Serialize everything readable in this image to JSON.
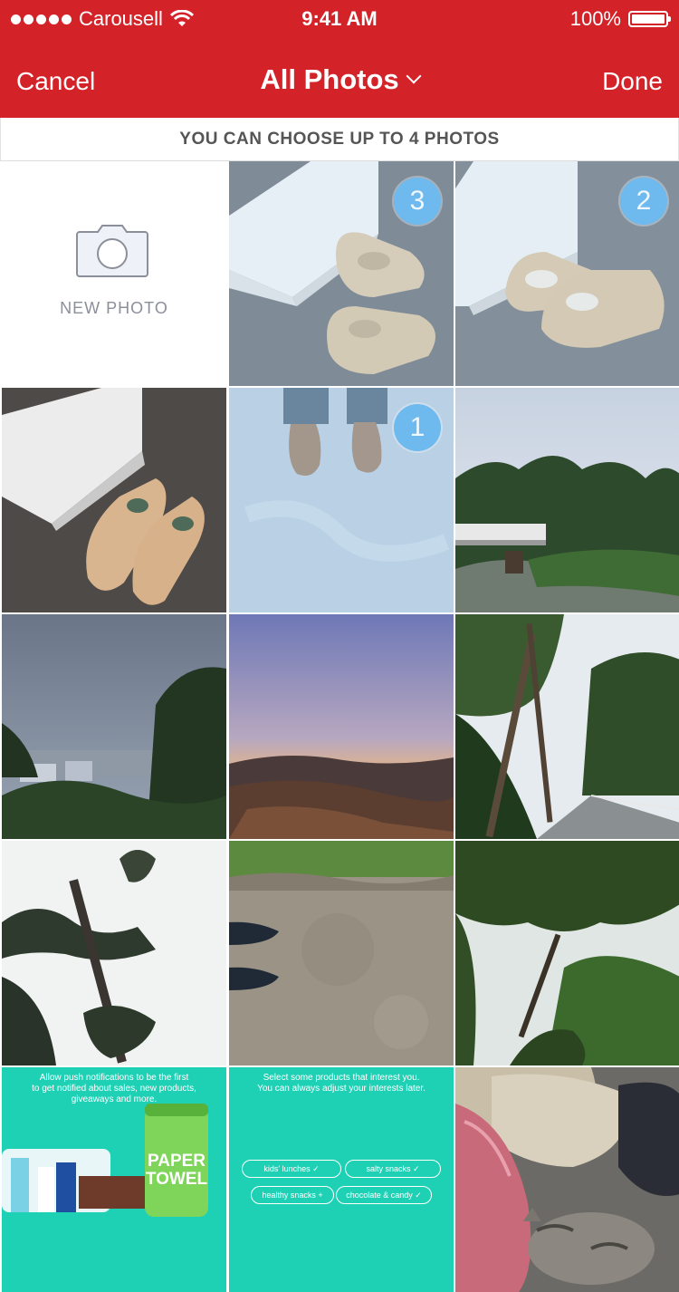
{
  "status_bar": {
    "carrier": "Carousell",
    "time": "9:41 AM",
    "battery": "100%"
  },
  "nav": {
    "cancel": "Cancel",
    "title": "All Photos",
    "done": "Done"
  },
  "hint": "YOU CAN CHOOSE UP TO 4 PHOTOS",
  "new_photo": {
    "label": "NEW PHOTO"
  },
  "selection_badges": {
    "sneakers_box_left": "3",
    "sneakers_box_right": "2",
    "shoes_on_floor": "1"
  },
  "screenshot_push": {
    "line1": "Allow push notifications to be the first",
    "line2": "to get notified about sales, new products,",
    "line3": "giveaways and more.",
    "product_label_1": "PAPER",
    "product_label_2": "TOWEL"
  },
  "screenshot_interests": {
    "line1": "Select some products that interest you.",
    "line2": "You can always adjust your interests later.",
    "pills": [
      "kids' lunches ✓",
      "salty snacks ✓",
      "healthy snacks +",
      "chocolate & candy ✓"
    ]
  },
  "colors": {
    "brand_red": "#d42229",
    "badge_blue": "#3a9fe3",
    "teal": "#1fd1b4"
  }
}
